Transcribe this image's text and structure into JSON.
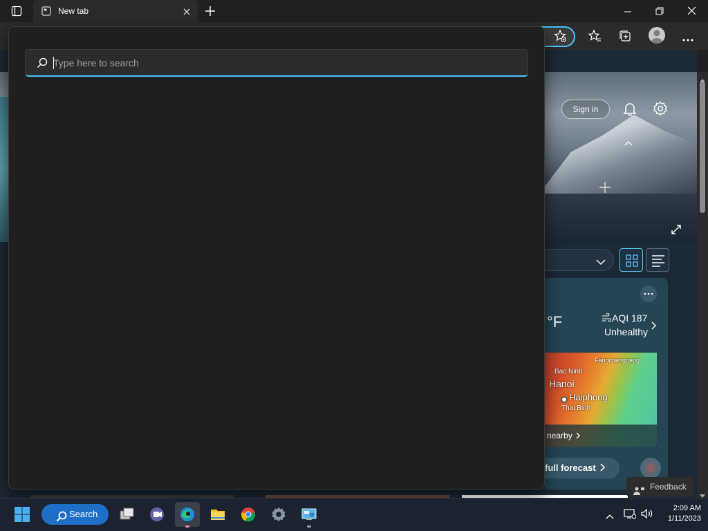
{
  "browser": {
    "tab_title": "New tab",
    "new_tab_icon": "plus-icon",
    "window_controls": [
      "minimize-icon",
      "restore-icon",
      "close-icon"
    ]
  },
  "page": {
    "sign_in_label": "Sign in",
    "weather": {
      "temp_unit": "°F",
      "aqi_label": "AQI 187",
      "aqi_status": "Unhealthy",
      "map_labels": [
        "Fangchenggang",
        "Bac Ninh",
        "Hanoi",
        "Haiphong",
        "Thai Binh"
      ],
      "nearby_label": "nearby",
      "forecast_label": "full forecast"
    },
    "feedback_label": "Feedback"
  },
  "flyout": {
    "search_placeholder": "Type here to search"
  },
  "taskbar": {
    "search_label": "Search",
    "time": "2:09 AM",
    "date": "1/11/2023",
    "apps": [
      "task-view-icon",
      "teams-icon",
      "edge-icon",
      "file-explorer-icon",
      "chrome-icon",
      "settings-icon",
      "control-panel-icon"
    ]
  },
  "colors": {
    "accent": "#4cc2ff",
    "taskbar_search": "#1f6fc9"
  }
}
